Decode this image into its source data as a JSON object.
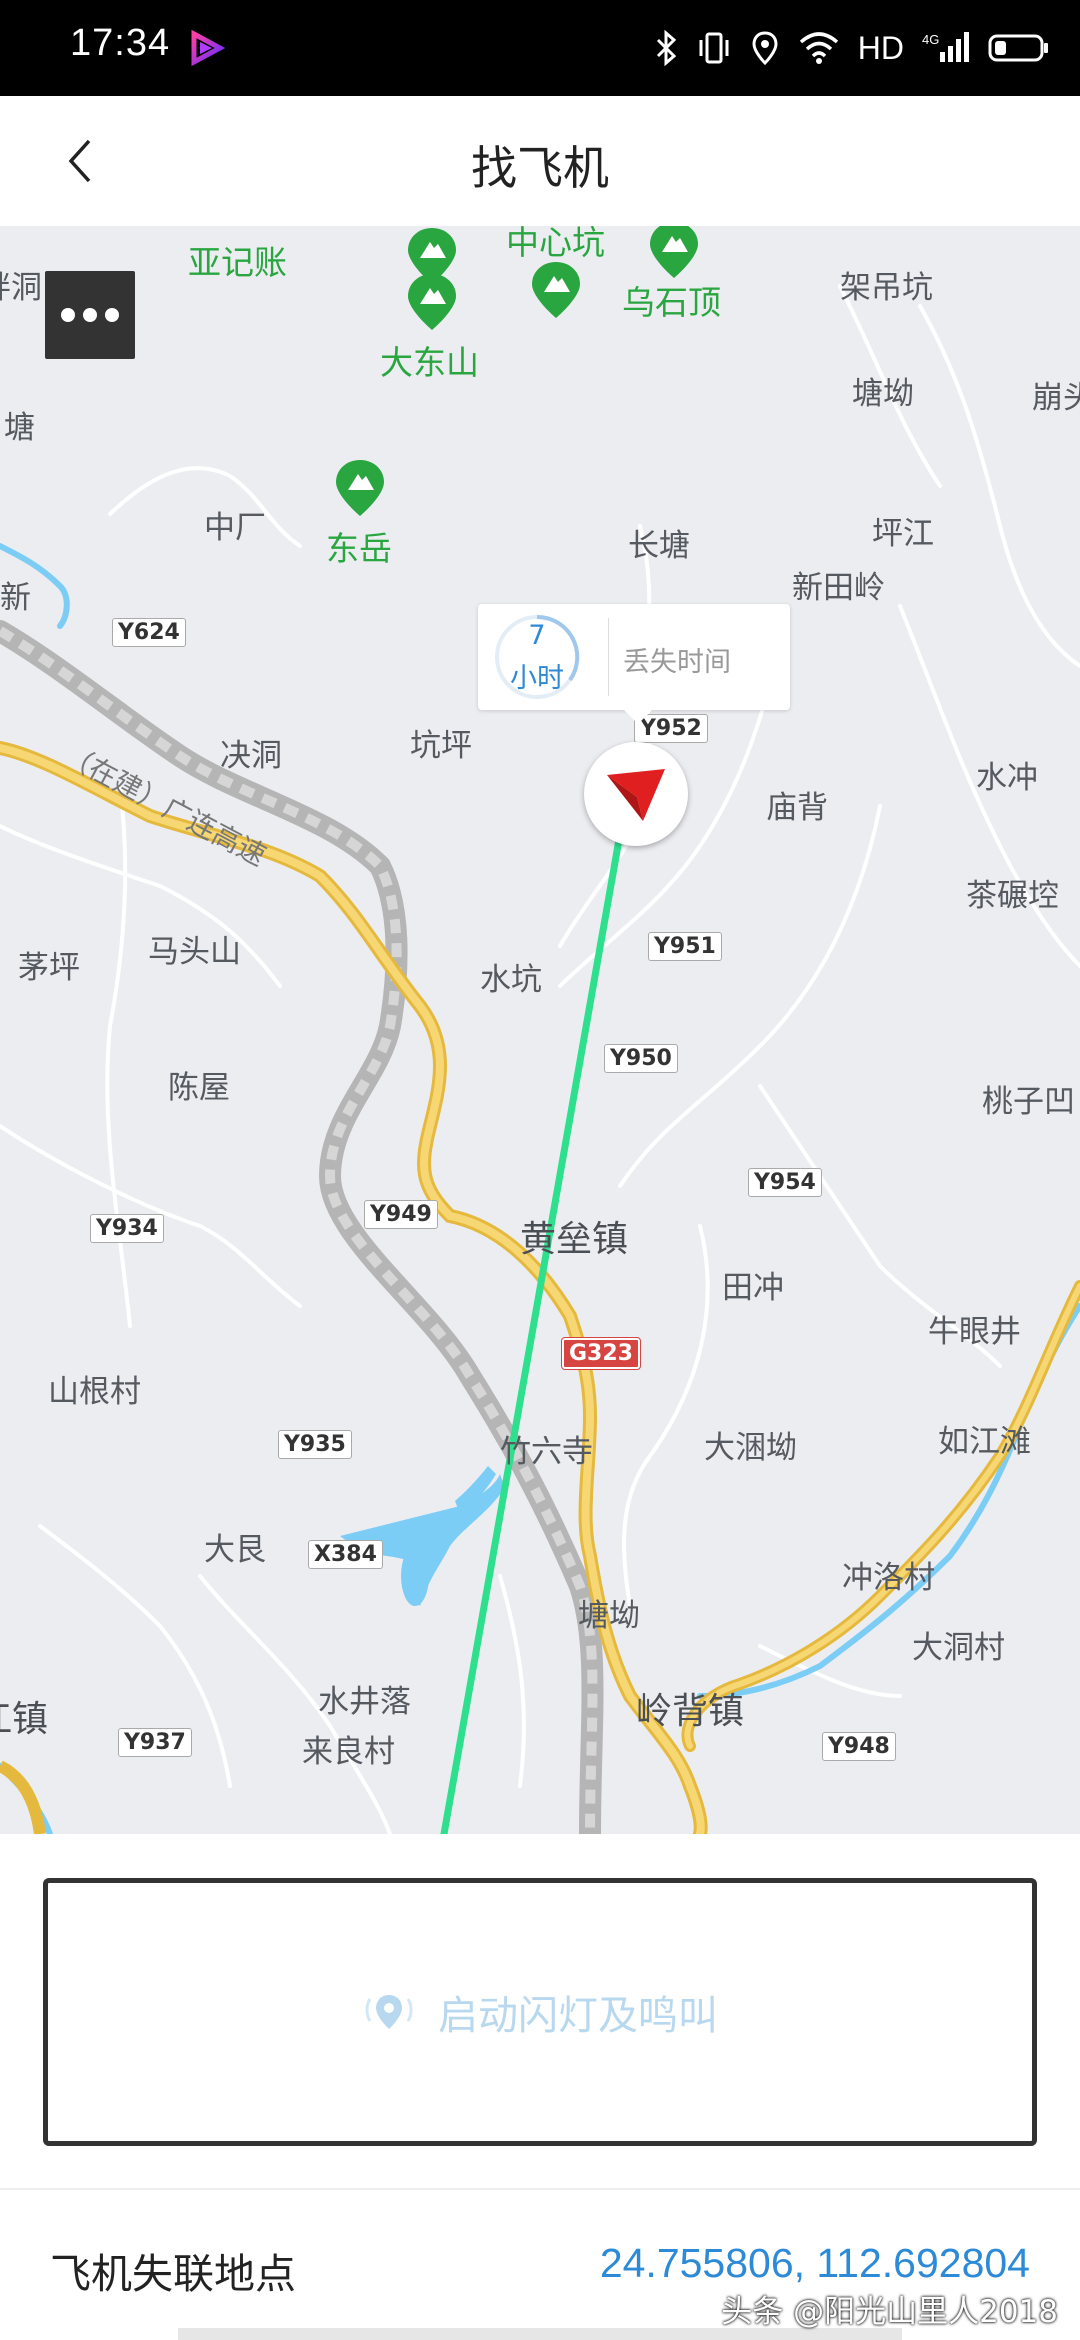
{
  "status_bar": {
    "time": "17:34",
    "network_label": "HD",
    "signal_label": "4G",
    "icons": [
      "app-icon",
      "bluetooth-icon",
      "vibrate-icon",
      "location-icon",
      "wifi-icon",
      "signal-icon",
      "battery-icon"
    ]
  },
  "header": {
    "title": "找飞机",
    "back_icon": "chevron-left-icon"
  },
  "map": {
    "places": {
      "yajizhang": "亚记账",
      "zhongxinkeng": "中心坑",
      "dadongshan": "大东山",
      "wushiding": "乌石顶",
      "jiadiaokeng": "架吊坑",
      "tangao1": "塘坳",
      "beng": "崩头",
      "pangdong": "畔洞",
      "tang": "塘",
      "zhongchang": "中厂",
      "dongyue": "东岳",
      "changtang": "长塘",
      "pingjiang": "坪江",
      "xintianling": "新田岭",
      "xin": "新",
      "juedong": "决洞",
      "kengping": "坑坪",
      "miaobei": "庙背",
      "shuichong": "水冲",
      "chanianqiang": "茶碾埪",
      "maoping": "茅坪",
      "matoushan": "马头山",
      "shuikeng": "水坑",
      "chenwu": "陈屋",
      "taoziao": "桃子凹",
      "huanglei": "黄垒镇",
      "tianchong": "田冲",
      "niuyanjing": "牛眼井",
      "shangencun": "山根村",
      "zhuliusi": "竹六寺",
      "dakunao": "大涃坳",
      "rujiangtan": "如江滩",
      "dagen": "大艮",
      "chongluocun": "冲洛村",
      "tangao2": "塘坳",
      "dadongcun": "大洞村",
      "shuijingluo": "水井落",
      "lingbei": "岭背镇",
      "jiangzhen": "江镇",
      "lailiangcun": "来良村",
      "expressway": "（在建）广连高速"
    },
    "roads": {
      "y624": "Y624",
      "y952": "Y952",
      "y951": "Y951",
      "y950": "Y950",
      "y954": "Y954",
      "y949": "Y949",
      "y934": "Y934",
      "g323": "G323",
      "y935": "Y935",
      "x384": "X384",
      "y937": "Y937",
      "y948": "Y948"
    },
    "more_icon": "more-dots-icon",
    "lost_bubble": {
      "hours_value": "7",
      "hours_unit": "小时",
      "lost_label": "丢失时间"
    },
    "plane_icon": "plane-arrow-icon"
  },
  "actions": {
    "flash_label": "启动闪灯及鸣叫",
    "flash_icon": "beacon-icon",
    "flash_disabled": true
  },
  "lost_location": {
    "label": "飞机失联地点",
    "coords": "24.755806, 112.692804"
  },
  "watermark": "头条 @阳光山里人2018",
  "colors": {
    "accent_blue": "#2d8ad6",
    "path_green": "#2ee08e",
    "marker_red": "#e02020",
    "highway_yellow": "#f2c94c",
    "water_blue": "#7ccdf5",
    "map_background": "#ecedf1"
  }
}
